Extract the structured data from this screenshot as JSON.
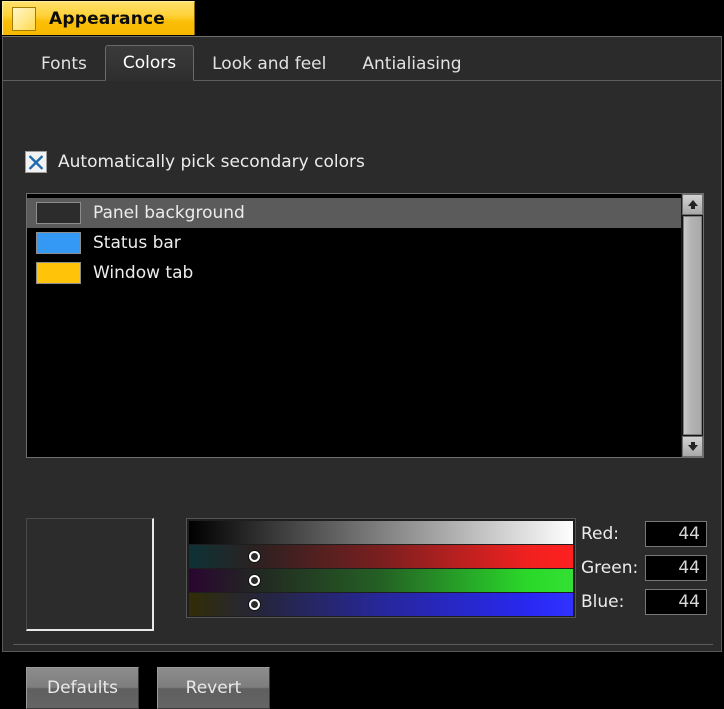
{
  "window": {
    "title": "Appearance",
    "icon": "swatch-icon"
  },
  "tabs": [
    {
      "label": "Fonts",
      "active": false
    },
    {
      "label": "Colors",
      "active": true
    },
    {
      "label": "Look and feel",
      "active": false
    },
    {
      "label": "Antialiasing",
      "active": false
    }
  ],
  "options": {
    "auto_pick_label": "Automatically pick secondary colors",
    "auto_pick_checked": true,
    "check_icon": "x-mark-icon",
    "check_color": "#1f6bb0"
  },
  "color_list": {
    "items": [
      {
        "label": "Panel background",
        "color": "#2c2c2c",
        "selected": true
      },
      {
        "label": "Status bar",
        "color": "#3399f5",
        "selected": false
      },
      {
        "label": "Window tab",
        "color": "#ffc40a",
        "selected": false
      }
    ],
    "selection_color": "#5b5b5b",
    "background": "#000000"
  },
  "scrollbar": {
    "up_icon": "arrow-up-icon",
    "down_icon": "arrow-down-icon",
    "thumb_position": "full"
  },
  "editor": {
    "preview_color": "#2c2c2c",
    "sliders": [
      {
        "name": "value",
        "channel": "gray",
        "percent": 0
      },
      {
        "name": "red",
        "channel": "red",
        "percent": 17.3
      },
      {
        "name": "green",
        "channel": "green",
        "percent": 17.3
      },
      {
        "name": "blue",
        "channel": "blue",
        "percent": 17.3
      }
    ],
    "fields": [
      {
        "label": "Red:",
        "value": "44"
      },
      {
        "label": "Green:",
        "value": "44"
      },
      {
        "label": "Blue:",
        "value": "44"
      }
    ]
  },
  "footer": {
    "defaults_label": "Defaults",
    "revert_label": "Revert"
  }
}
